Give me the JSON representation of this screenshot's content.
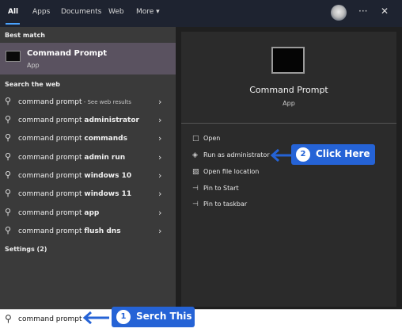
{
  "tabs": [
    {
      "label": "All"
    },
    {
      "label": "Apps"
    },
    {
      "label": "Documents"
    },
    {
      "label": "Web"
    },
    {
      "label": "More ▾"
    }
  ],
  "topbar": {
    "more_options": "···",
    "close": "✕"
  },
  "best_match": {
    "heading": "Best match",
    "title": "Command Prompt",
    "subtitle": "App"
  },
  "search_web": {
    "heading": "Search the web",
    "items": [
      {
        "plain": "command prompt",
        "bold": "",
        "suffix": " - See web results"
      },
      {
        "plain": "command prompt ",
        "bold": "administrator",
        "suffix": ""
      },
      {
        "plain": "command prompt ",
        "bold": "commands",
        "suffix": ""
      },
      {
        "plain": "command prompt ",
        "bold": "admin run",
        "suffix": ""
      },
      {
        "plain": "command prompt ",
        "bold": "windows 10",
        "suffix": ""
      },
      {
        "plain": "command prompt ",
        "bold": "windows 11",
        "suffix": ""
      },
      {
        "plain": "command prompt ",
        "bold": "app",
        "suffix": ""
      },
      {
        "plain": "command prompt ",
        "bold": "flush dns",
        "suffix": ""
      }
    ]
  },
  "settings": {
    "heading": "Settings (2)"
  },
  "preview": {
    "title": "Command Prompt",
    "subtitle": "App",
    "actions": [
      {
        "label": "Open",
        "icon": "open-icon"
      },
      {
        "label": "Run as administrator",
        "icon": "shield-icon"
      },
      {
        "label": "Open file location",
        "icon": "folder-icon"
      },
      {
        "label": "Pin to Start",
        "icon": "pin-icon"
      },
      {
        "label": "Pin to taskbar",
        "icon": "pin-icon"
      }
    ]
  },
  "search": {
    "value": "command prompt"
  },
  "callouts": [
    {
      "number": "1",
      "text": "Serch This"
    },
    {
      "number": "2",
      "text": "Click Here"
    }
  ],
  "colors": {
    "accent": "#2563d6",
    "best_match_bg": "#5a5260"
  }
}
